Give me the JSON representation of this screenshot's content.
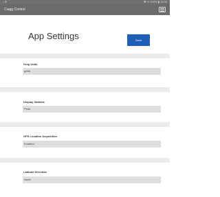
{
  "status_bar": {
    "left": "• ☰",
    "right": "✱ ᯤ 100% ▮ 12:00"
  },
  "app_bar": {
    "title": "Ciagg Control"
  },
  "header": {
    "title": "App Settings",
    "save_label": "Save"
  },
  "settings": [
    {
      "label": "Drop Units",
      "value": "g/Mix"
    },
    {
      "label": "Display Statistic",
      "value": "Peak"
    },
    {
      "label": "GPS Location Acquisition",
      "value": "Enabled"
    },
    {
      "label": "Latitude Direction",
      "value": "North"
    }
  ]
}
